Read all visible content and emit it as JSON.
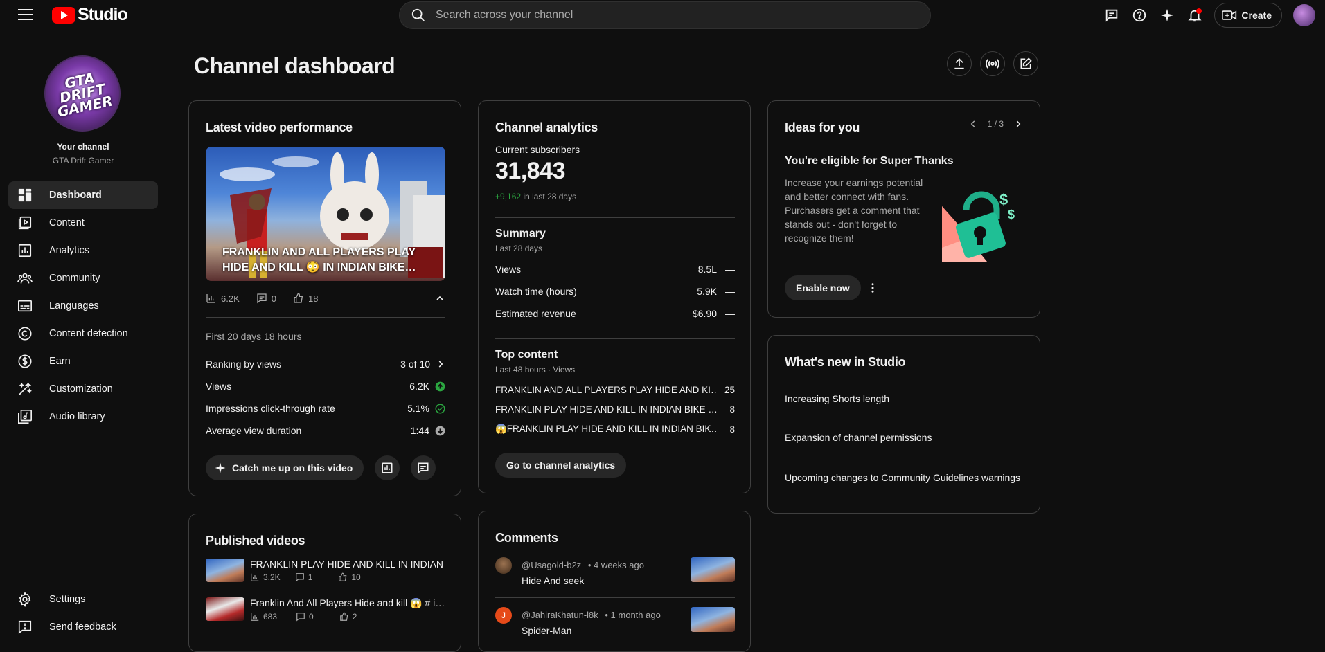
{
  "topbar": {
    "logo_text": "Studio",
    "search_placeholder": "Search across your channel",
    "create_label": "Create"
  },
  "sidebar": {
    "avatar_text": "GTA DRIFT GAMER",
    "your_channel": "Your channel",
    "channel_name": "GTA Drift Gamer",
    "items": [
      {
        "label": "Dashboard",
        "icon": "dashboard-icon"
      },
      {
        "label": "Content",
        "icon": "content-icon"
      },
      {
        "label": "Analytics",
        "icon": "analytics-icon"
      },
      {
        "label": "Community",
        "icon": "community-icon"
      },
      {
        "label": "Languages",
        "icon": "languages-icon"
      },
      {
        "label": "Content detection",
        "icon": "copyright-icon"
      },
      {
        "label": "Earn",
        "icon": "earn-icon"
      },
      {
        "label": "Customization",
        "icon": "customization-icon"
      },
      {
        "label": "Audio library",
        "icon": "audio-library-icon"
      }
    ],
    "settings": "Settings",
    "feedback": "Send feedback"
  },
  "main": {
    "title": "Channel dashboard"
  },
  "latest": {
    "title": "Latest video performance",
    "video_title": "FRANKLIN AND ALL PLAYERS PLAY HIDE AND KILL 😳 IN INDIAN BIKE…",
    "views": "6.2K",
    "comments": "0",
    "likes": "18",
    "period": "First 20 days 18 hours",
    "metrics": [
      {
        "label": "Ranking by views",
        "value": "3 of 10"
      },
      {
        "label": "Views",
        "value": "6.2K",
        "status": "#2ba640"
      },
      {
        "label": "Impressions click-through rate",
        "value": "5.1%",
        "status": "#2ba640"
      },
      {
        "label": "Average view duration",
        "value": "1:44",
        "status": "#aaaaaa"
      }
    ],
    "catch_up": "Catch me up on this video"
  },
  "published": {
    "title": "Published videos",
    "videos": [
      {
        "title": "FRANKLIN PLAY HIDE AND KILL IN INDIAN …",
        "views": "3.2K",
        "comments": "1",
        "likes": "10"
      },
      {
        "title": "Franklin And All Players Hide and kill 😱 # i…",
        "views": "683",
        "comments": "0",
        "likes": "2"
      }
    ]
  },
  "analytics": {
    "title": "Channel analytics",
    "subs_label": "Current subscribers",
    "subs_value": "31,843",
    "subs_change": "+9,162",
    "subs_change_suffix": "in last 28 days",
    "summary_title": "Summary",
    "summary_period": "Last 28 days",
    "summary": [
      {
        "label": "Views",
        "value": "8.5L",
        "trend": "—"
      },
      {
        "label": "Watch time (hours)",
        "value": "5.9K",
        "trend": "—"
      },
      {
        "label": "Estimated revenue",
        "value": "$6.90",
        "trend": "—"
      }
    ],
    "top_title": "Top content",
    "top_period": "Last 48 hours · Views",
    "top": [
      {
        "title": "FRANKLIN AND ALL PLAYERS PLAY HIDE AND KI…",
        "value": "25"
      },
      {
        "title": "FRANKLIN PLAY HIDE AND KILL IN INDIAN BIKE …",
        "value": "8"
      },
      {
        "title": "😱FRANKLIN PLAY HIDE AND KILL IN INDIAN BIK…",
        "value": "8"
      }
    ],
    "go_button": "Go to channel analytics"
  },
  "comments": {
    "title": "Comments",
    "items": [
      {
        "user": "@Usagold-b2z",
        "time": "• 4 weeks ago",
        "text": "Hide And seek",
        "avatar_letter": "",
        "avatar_color": "#6b4a2e"
      },
      {
        "user": "@JahiraKhatun-l8k",
        "time": "• 1 month ago",
        "text": "Spider-Man",
        "avatar_letter": "J",
        "avatar_color": "#e64a19"
      }
    ]
  },
  "ideas": {
    "title": "Ideas for you",
    "pager": "1 / 3",
    "heading": "You're eligible for Super Thanks",
    "body": "Increase your earnings potential and better connect with fans. Purchasers get a comment that stands out - don't forget to recognize them!",
    "button": "Enable now"
  },
  "whats_new": {
    "title": "What's new in Studio",
    "items": [
      "Increasing Shorts length",
      "Expansion of channel permissions",
      "Upcoming changes to Community Guidelines warnings"
    ]
  }
}
